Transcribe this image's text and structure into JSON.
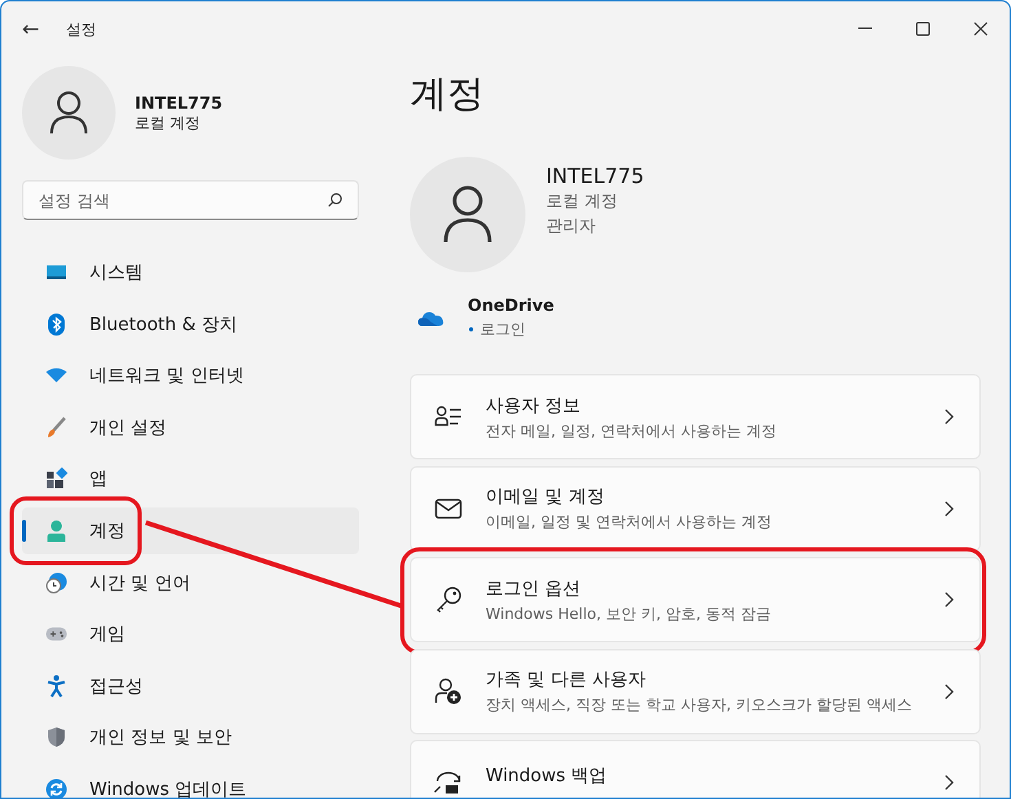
{
  "window": {
    "title": "설정",
    "back": "←"
  },
  "profile": {
    "name": "INTEL775",
    "account_type": "로컬 계정"
  },
  "search": {
    "placeholder": "설정 검색"
  },
  "nav": {
    "items": [
      {
        "label": "시스템",
        "selected": false,
        "annotated": false
      },
      {
        "label": "Bluetooth & 장치",
        "selected": false,
        "annotated": false
      },
      {
        "label": "네트워크 및 인터넷",
        "selected": false,
        "annotated": false
      },
      {
        "label": "개인 설정",
        "selected": false,
        "annotated": false
      },
      {
        "label": "앱",
        "selected": false,
        "annotated": false
      },
      {
        "label": "계정",
        "selected": true,
        "annotated": true
      },
      {
        "label": "시간 및 언어",
        "selected": false,
        "annotated": false
      },
      {
        "label": "게임",
        "selected": false,
        "annotated": false
      },
      {
        "label": "접근성",
        "selected": false,
        "annotated": false
      },
      {
        "label": "개인 정보 및 보안",
        "selected": false,
        "annotated": false
      },
      {
        "label": "Windows 업데이트",
        "selected": false,
        "annotated": false
      }
    ]
  },
  "page": {
    "title": "계정",
    "account": {
      "name": "INTEL775",
      "type": "로컬 계정",
      "role": "관리자"
    },
    "onedrive": {
      "name": "OneDrive",
      "status": "로그인"
    },
    "cards": [
      {
        "title": "사용자 정보",
        "subtitle": "전자 메일, 일정, 연락처에서 사용하는 계정",
        "annotated": false
      },
      {
        "title": "이메일 및 계정",
        "subtitle": "이메일, 일정 및 연락처에서 사용하는 계정",
        "annotated": false
      },
      {
        "title": "로그인 옵션",
        "subtitle": "Windows Hello, 보안 키, 암호, 동적 잠금",
        "annotated": true
      },
      {
        "title": "가족 및 다른 사용자",
        "subtitle": "장치 액세스, 직장 또는 학교 사용자, 키오스크가 할당된 액세스",
        "annotated": false
      },
      {
        "title": "Windows 백업",
        "annotated": false
      }
    ]
  }
}
